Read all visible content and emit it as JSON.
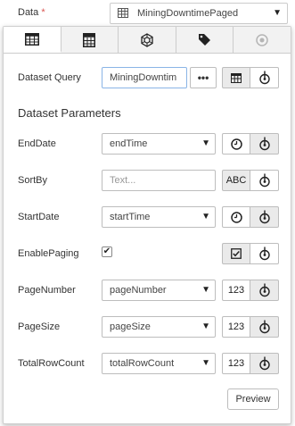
{
  "field": {
    "label": "Data",
    "required_mark": "*",
    "selected_value": "MiningDowntimePaged"
  },
  "tabs": [
    {
      "icon": "table-icon",
      "active": true
    },
    {
      "icon": "calculator-icon",
      "active": false
    },
    {
      "icon": "network-icon",
      "active": false
    },
    {
      "icon": "tag-icon",
      "active": false
    },
    {
      "icon": "circle-icon",
      "active": false,
      "disabled": true
    }
  ],
  "dataset_query": {
    "label": "Dataset Query",
    "value": "MiningDowntim",
    "more_label": "•••"
  },
  "parameters_title": "Dataset Parameters",
  "parameters": [
    {
      "label": "EndDate",
      "kind": "select",
      "value": "endTime",
      "type_icon": "clock-icon",
      "type_label": ""
    },
    {
      "label": "SortBy",
      "kind": "text",
      "placeholder": "Text...",
      "type_icon": "text-type-icon",
      "type_label": "ABC"
    },
    {
      "label": "StartDate",
      "kind": "select",
      "value": "startTime",
      "type_icon": "clock-icon",
      "type_label": ""
    },
    {
      "label": "EnablePaging",
      "kind": "checkbox",
      "checked": true,
      "type_icon": "checkbox-type-icon",
      "type_label": ""
    },
    {
      "label": "PageNumber",
      "kind": "select",
      "value": "pageNumber",
      "type_icon": "number-type-icon",
      "type_label": "123"
    },
    {
      "label": "PageSize",
      "kind": "select",
      "value": "pageSize",
      "type_icon": "number-type-icon",
      "type_label": "123"
    },
    {
      "label": "TotalRowCount",
      "kind": "select",
      "value": "totalRowCount",
      "type_icon": "number-type-icon",
      "type_label": "123"
    }
  ],
  "preview_label": "Preview",
  "colors": {
    "required": "#d9534f",
    "focus_border": "#8ab4e6",
    "toggle_active_bg": "#eaeaea"
  }
}
